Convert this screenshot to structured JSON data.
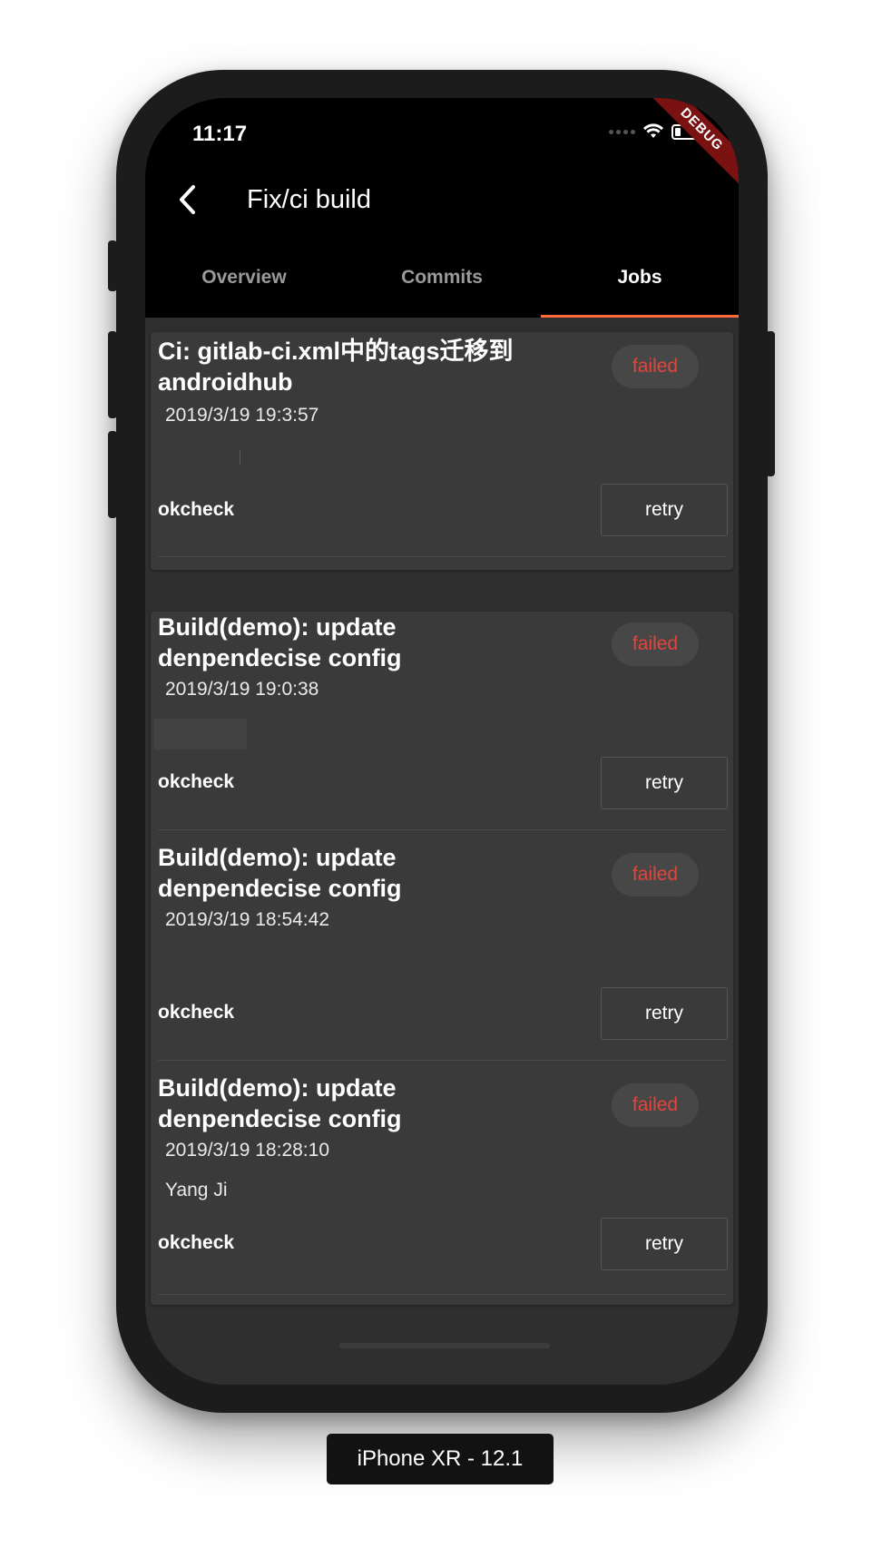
{
  "status_bar": {
    "time": "11:17"
  },
  "debug_banner": "DEBUG",
  "app_bar": {
    "title": "Fix/ci build",
    "back_icon": "chevron-left-icon"
  },
  "tabs": [
    {
      "label": "Overview",
      "active": false
    },
    {
      "label": "Commits",
      "active": false
    },
    {
      "label": "Jobs",
      "active": true
    }
  ],
  "jobs": [
    {
      "title": "Ci: gitlab-ci.xml中的tags迁移到androidhub",
      "date": "2019/3/19 19:3:57",
      "author": "",
      "status": "failed",
      "stage": "okcheck",
      "action": "retry"
    },
    {
      "title": "Build(demo): update denpendecise config",
      "date": "2019/3/19 19:0:38",
      "author": "",
      "status": "failed",
      "stage": "okcheck",
      "action": "retry"
    },
    {
      "title": "Build(demo): update denpendecise config",
      "date": "2019/3/19 18:54:42",
      "author": "",
      "status": "failed",
      "stage": "okcheck",
      "action": "retry"
    },
    {
      "title": "Build(demo): update denpendecise config",
      "date": "2019/3/19 18:28:10",
      "author": "Yang Ji",
      "status": "failed",
      "stage": "okcheck",
      "action": "retry"
    }
  ],
  "colors": {
    "accent": "#ff6a3d",
    "failed": "#e6443a",
    "background": "#2f2f2f",
    "card": "#3a3a3a"
  },
  "device_label": "iPhone XR - 12.1"
}
